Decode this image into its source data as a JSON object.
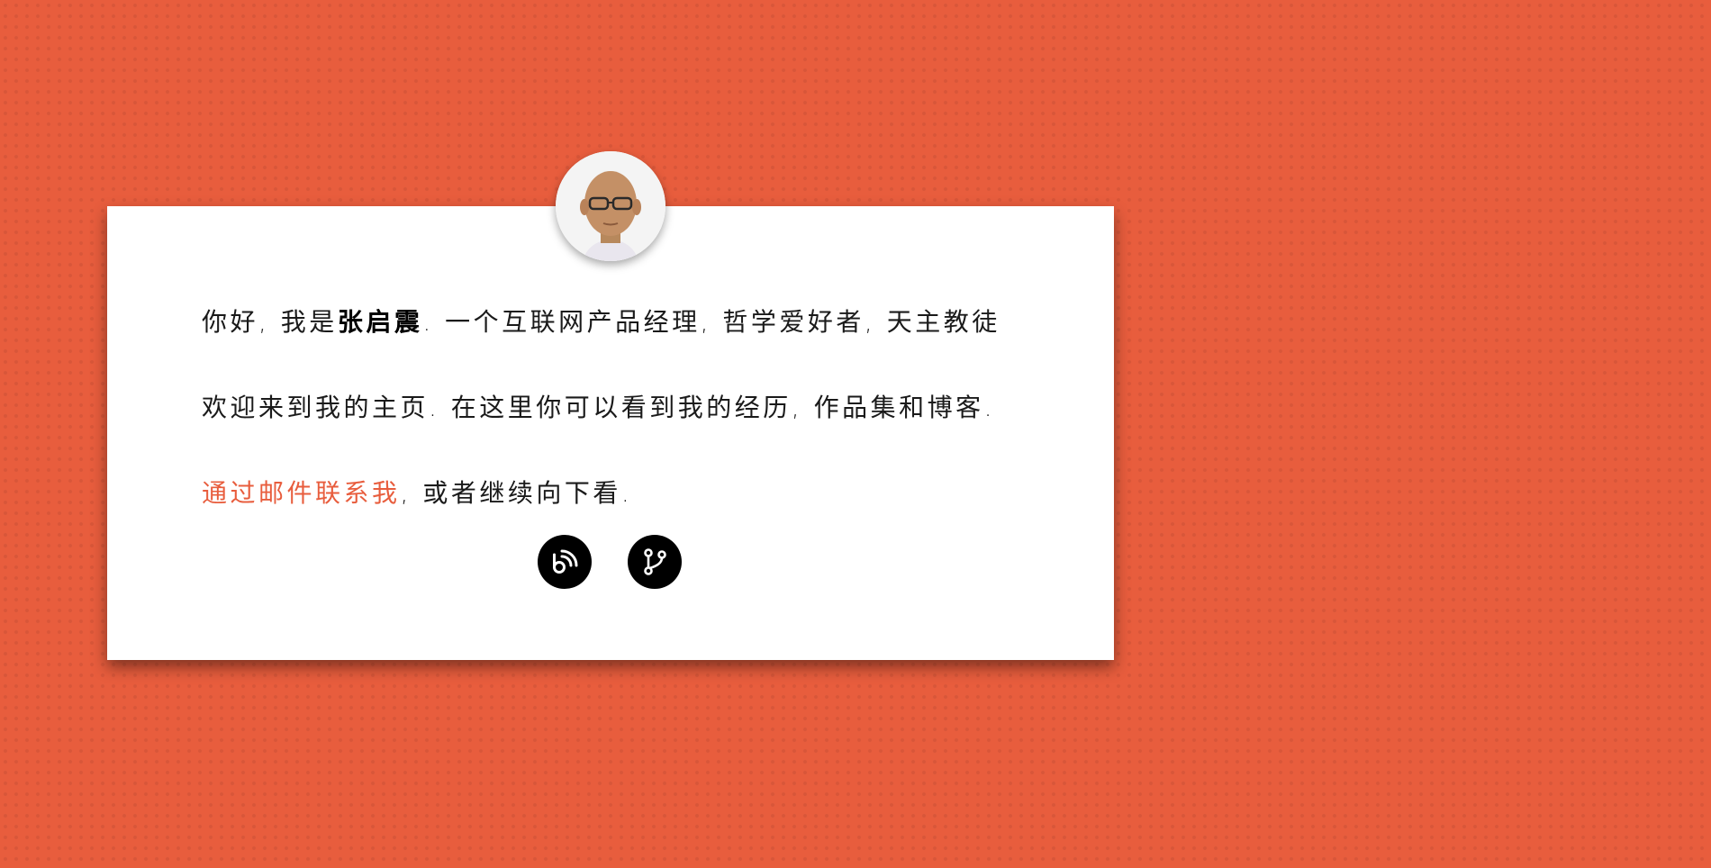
{
  "intro": {
    "greeting": "你好, 我是",
    "name": "张启震",
    "description": ". 一个互联网产品经理, 哲学爱好者, 天主教徒",
    "welcome": "欢迎来到我的主页. 在这里你可以看到我的经历, 作品集和博客.",
    "contact_link": "通过邮件联系我",
    "contact_suffix": ", 或者继续向下看."
  },
  "social": [
    {
      "icon": "weibo-icon"
    },
    {
      "icon": "git-branch-icon"
    }
  ],
  "colors": {
    "background": "#e85d3d",
    "accent": "#e85d3d",
    "card": "#ffffff"
  }
}
